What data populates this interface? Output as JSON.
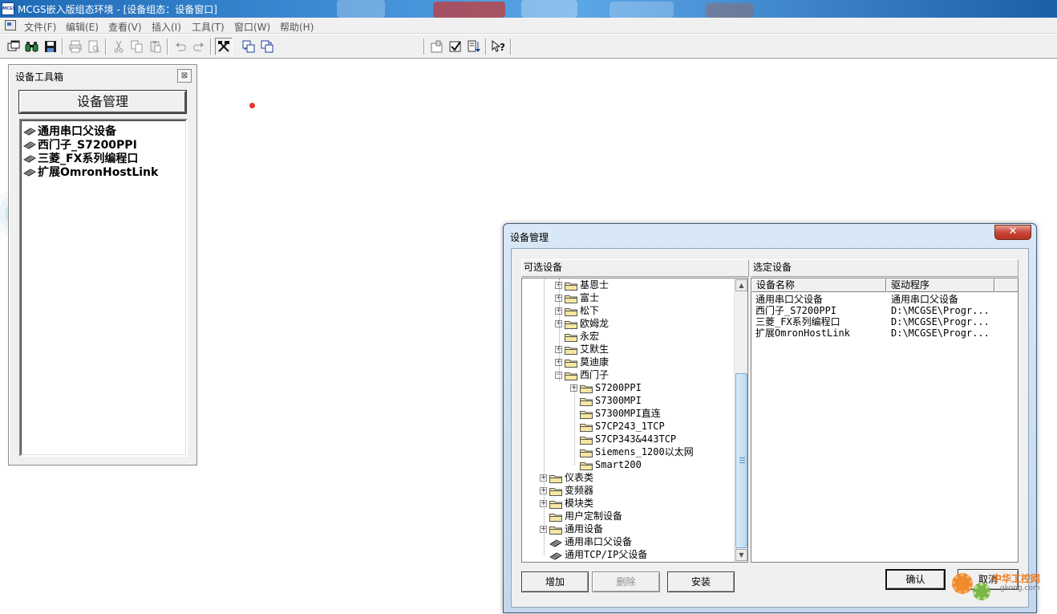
{
  "window": {
    "title": "MCGS嵌入版组态环境 - [设备组态：设备窗口]",
    "icon_text": "MCGS"
  },
  "menu": [
    "文件(F)",
    "编辑(E)",
    "查看(V)",
    "插入(I)",
    "工具(T)",
    "窗口(W)",
    "帮助(H)"
  ],
  "toolbar_icons": [
    "new-window-icon",
    "binoculars-icon",
    "save-icon",
    "print-icon",
    "print-preview-icon",
    "cut-icon",
    "copy-icon",
    "paste-icon",
    "undo-icon",
    "redo-icon",
    "tools-icon",
    "device-prop-icon",
    "device-link-icon",
    "properties-icon",
    "check-icon",
    "sort-icon",
    "help-icon"
  ],
  "toolbox": {
    "title": "设备工具箱",
    "close_glyph": "⊠",
    "manage_button": "设备管理",
    "items": [
      "通用串口父设备",
      "西门子_S7200PPI",
      "三菱_FX系列编程口",
      "扩展OmronHostLink"
    ]
  },
  "dialog": {
    "title": "设备管理",
    "close_glyph": "✕",
    "available_label": "可选设备",
    "selected_label": "选定设备",
    "tree": [
      {
        "label": "基恩士",
        "level": 2,
        "expander": "+",
        "icon": "folder"
      },
      {
        "label": "富士",
        "level": 2,
        "expander": "+",
        "icon": "folder"
      },
      {
        "label": "松下",
        "level": 2,
        "expander": "+",
        "icon": "folder"
      },
      {
        "label": "欧姆龙",
        "level": 2,
        "expander": "+",
        "icon": "folder"
      },
      {
        "label": "永宏",
        "level": 2,
        "expander": "",
        "icon": "folder"
      },
      {
        "label": "艾默生",
        "level": 2,
        "expander": "+",
        "icon": "folder"
      },
      {
        "label": "莫迪康",
        "level": 2,
        "expander": "+",
        "icon": "folder"
      },
      {
        "label": "西门子",
        "level": 2,
        "expander": "-",
        "icon": "folder"
      },
      {
        "label": "S7200PPI",
        "level": 3,
        "expander": "+",
        "icon": "folder"
      },
      {
        "label": "S7300MPI",
        "level": 3,
        "expander": "",
        "icon": "folder"
      },
      {
        "label": "S7300MPI直连",
        "level": 3,
        "expander": "",
        "icon": "folder"
      },
      {
        "label": "S7CP243_1TCP",
        "level": 3,
        "expander": "",
        "icon": "folder"
      },
      {
        "label": "S7CP343&443TCP",
        "level": 3,
        "expander": "",
        "icon": "folder"
      },
      {
        "label": "Siemens_1200以太网",
        "level": 3,
        "expander": "",
        "icon": "folder"
      },
      {
        "label": "Smart200",
        "level": 3,
        "expander": "",
        "icon": "folder"
      },
      {
        "label": "仪表类",
        "level": 1,
        "expander": "+",
        "icon": "folder"
      },
      {
        "label": "变频器",
        "level": 1,
        "expander": "+",
        "icon": "folder"
      },
      {
        "label": "模块类",
        "level": 1,
        "expander": "+",
        "icon": "folder"
      },
      {
        "label": "用户定制设备",
        "level": 1,
        "expander": "",
        "icon": "folder"
      },
      {
        "label": "通用设备",
        "level": 1,
        "expander": "+",
        "icon": "folder"
      },
      {
        "label": "通用串口父设备",
        "level": 1,
        "expander": "",
        "icon": "device"
      },
      {
        "label": "通用TCP/IP父设备",
        "level": 1,
        "expander": "",
        "icon": "device"
      }
    ],
    "columns": [
      "设备名称",
      "驱动程序"
    ],
    "rows": [
      [
        "通用串口父设备",
        "通用串口父设备"
      ],
      [
        "西门子_S7200PPI",
        "D:\\MCGSE\\Progr..."
      ],
      [
        "三菱_FX系列编程口",
        "D:\\MCGSE\\Progr..."
      ],
      [
        "扩展OmronHostLink",
        "D:\\MCGSE\\Progr..."
      ]
    ],
    "buttons": {
      "add": "增加",
      "delete": "删除",
      "install": "安装",
      "ok": "确认",
      "cancel": "取消"
    }
  },
  "watermark": {
    "text": "中华工控网",
    "url": "gkong.com"
  },
  "colors": {
    "title_bar": "#3c8ad3",
    "dialog_frame": "#c3d8ec",
    "close_button": "#c9473a",
    "red_dot": "#e8322e"
  }
}
